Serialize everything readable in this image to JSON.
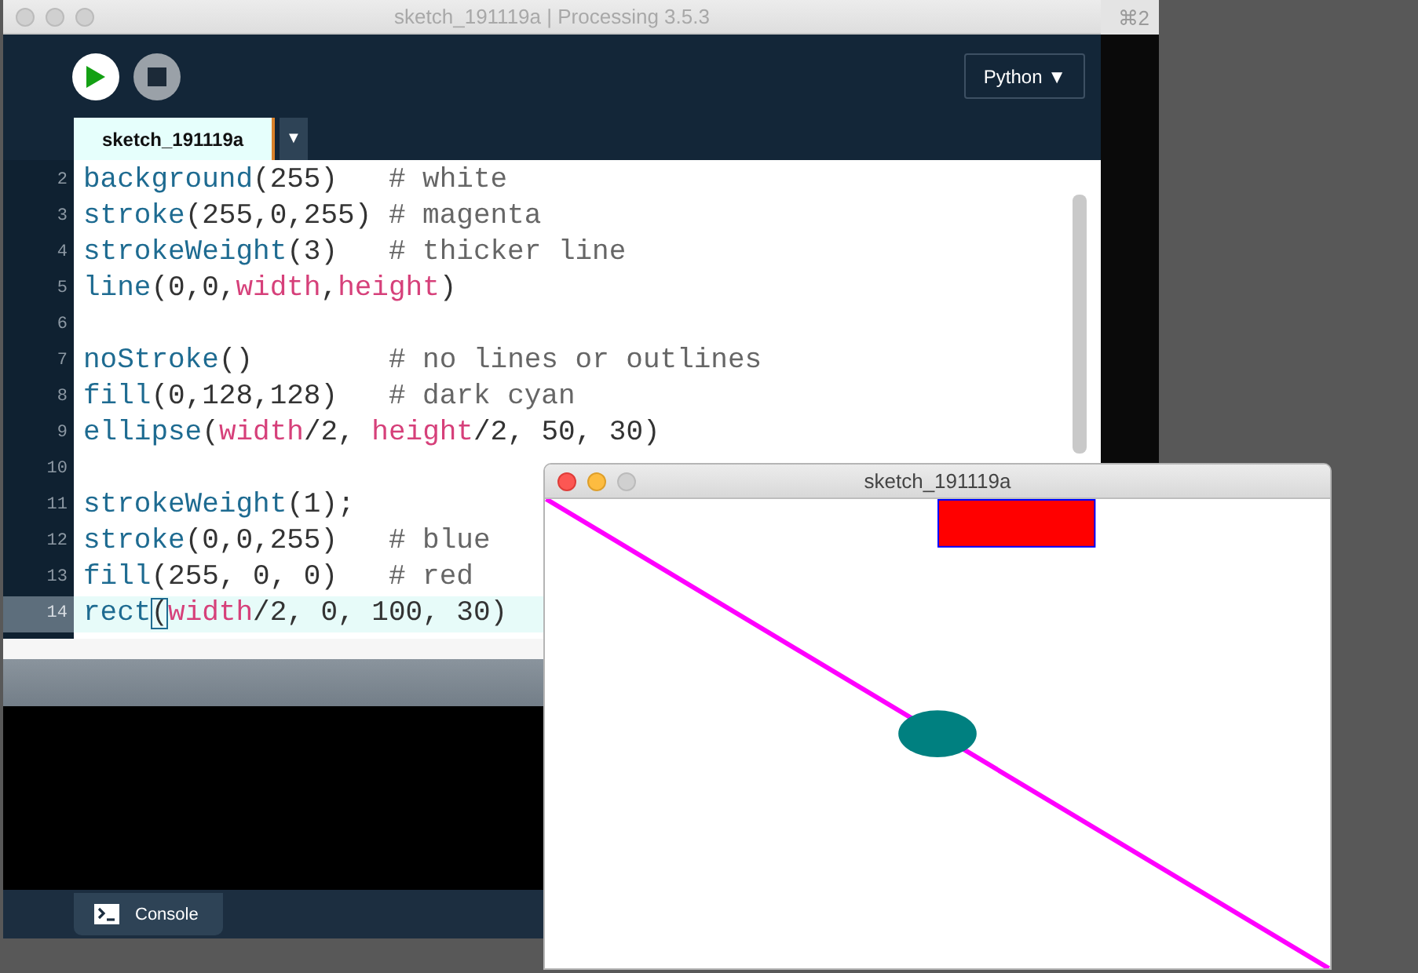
{
  "background_window": {
    "title_fragment": "⌘2"
  },
  "ide": {
    "title": "sketch_191119a | Processing 3.5.3",
    "mode_button": "Python ▼",
    "tabs": [
      {
        "label": "sketch_191119a",
        "selected": true
      }
    ],
    "tab_menu": "▼",
    "lines": [
      {
        "number": "2",
        "current": false,
        "segments": [
          {
            "kind": "function",
            "text": "background"
          },
          {
            "kind": "plain",
            "text": "(255)   "
          },
          {
            "kind": "comment",
            "text": "# white"
          }
        ]
      },
      {
        "number": "3",
        "current": false,
        "segments": [
          {
            "kind": "function",
            "text": "stroke"
          },
          {
            "kind": "plain",
            "text": "(255,0,255) "
          },
          {
            "kind": "comment",
            "text": "# magenta"
          }
        ]
      },
      {
        "number": "4",
        "current": false,
        "segments": [
          {
            "kind": "function",
            "text": "strokeWeight"
          },
          {
            "kind": "plain",
            "text": "(3)   "
          },
          {
            "kind": "comment",
            "text": "# thicker line"
          }
        ]
      },
      {
        "number": "5",
        "current": false,
        "segments": [
          {
            "kind": "function",
            "text": "line"
          },
          {
            "kind": "plain",
            "text": "(0,0,"
          },
          {
            "kind": "variable",
            "text": "width"
          },
          {
            "kind": "plain",
            "text": ","
          },
          {
            "kind": "variable",
            "text": "height"
          },
          {
            "kind": "plain",
            "text": ")"
          }
        ]
      },
      {
        "number": "6",
        "current": false
      },
      {
        "number": "7",
        "current": false,
        "segments": [
          {
            "kind": "function",
            "text": "noStroke"
          },
          {
            "kind": "plain",
            "text": "()        "
          },
          {
            "kind": "comment",
            "text": "# no lines or outlines"
          }
        ]
      },
      {
        "number": "8",
        "current": false,
        "segments": [
          {
            "kind": "function",
            "text": "fill"
          },
          {
            "kind": "plain",
            "text": "(0,128,128)   "
          },
          {
            "kind": "comment",
            "text": "# dark cyan"
          }
        ]
      },
      {
        "number": "9",
        "current": false,
        "segments": [
          {
            "kind": "function",
            "text": "ellipse"
          },
          {
            "kind": "plain",
            "text": "("
          },
          {
            "kind": "variable",
            "text": "width"
          },
          {
            "kind": "plain",
            "text": "/2, "
          },
          {
            "kind": "variable",
            "text": "height"
          },
          {
            "kind": "plain",
            "text": "/2, 50, 30)"
          }
        ]
      },
      {
        "number": "10",
        "current": false
      },
      {
        "number": "11",
        "current": false,
        "segments": [
          {
            "kind": "function",
            "text": "strokeWeight"
          },
          {
            "kind": "plain",
            "text": "(1);"
          }
        ]
      },
      {
        "number": "12",
        "current": false,
        "segments": [
          {
            "kind": "function",
            "text": "stroke"
          },
          {
            "kind": "plain",
            "text": "(0,0,255)   "
          },
          {
            "kind": "comment",
            "text": "# blue"
          }
        ]
      },
      {
        "number": "13",
        "current": false,
        "segments": [
          {
            "kind": "function",
            "text": "fill"
          },
          {
            "kind": "plain",
            "text": "(255, 0, 0)   "
          },
          {
            "kind": "comment",
            "text": "# red"
          }
        ]
      },
      {
        "number": "14",
        "current": true,
        "segments": [
          {
            "kind": "function",
            "text": "rect"
          },
          {
            "kind": "bracket_match",
            "text": "("
          },
          {
            "kind": "variable",
            "text": "width"
          },
          {
            "kind": "plain",
            "text": "/2, 0, 100, 30)"
          }
        ]
      }
    ],
    "console_tab": "Console"
  },
  "sketch_window": {
    "title": "sketch_191119a"
  }
}
